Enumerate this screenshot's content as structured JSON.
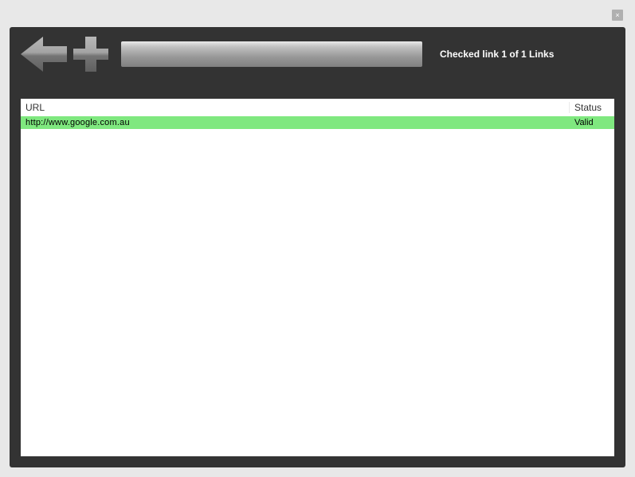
{
  "window": {
    "close_glyph": "×"
  },
  "toolbar": {
    "status": "Checked link 1 of 1 Links"
  },
  "table": {
    "headers": {
      "url": "URL",
      "status": "Status"
    },
    "rows": [
      {
        "url": "http://www.google.com.au",
        "status": "Valid"
      }
    ]
  }
}
